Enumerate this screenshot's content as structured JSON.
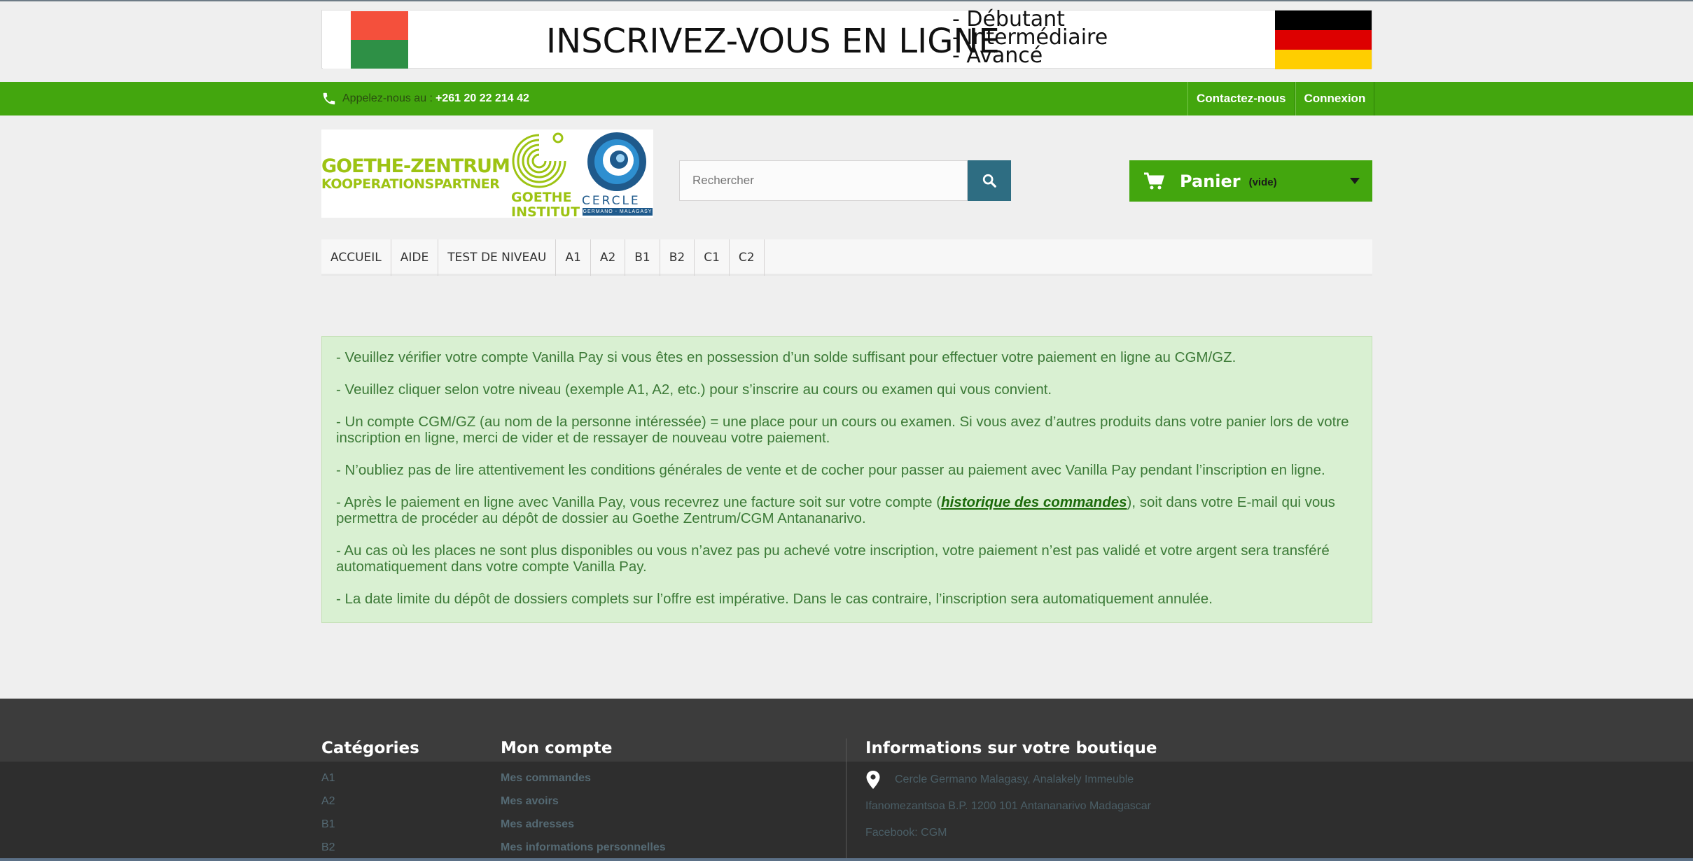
{
  "banner": {
    "title": "INSCRIVEZ-VOUS EN LIGNE",
    "levels": [
      "- Débutant",
      "- Intermédiaire",
      "- Avancé"
    ]
  },
  "topbar": {
    "phone_label": "Appelez-nous au :",
    "phone_number": "+261 20 22 214 42",
    "links": [
      "Contactez-nous",
      "Connexion"
    ]
  },
  "logo": {
    "line1": "GOETHE-ZENTRUM",
    "line2": "KOOPERATIONSPARTNER",
    "goethe": [
      "GOETHE",
      "INSTITUT"
    ],
    "cercle": "CERCLE",
    "cercle_sub": "GERMANO - MALAGASY"
  },
  "search": {
    "placeholder": "Rechercher"
  },
  "cart": {
    "label": "Panier",
    "status": "(vide)"
  },
  "nav": [
    "ACCUEIL",
    "AIDE",
    "TEST DE NIVEAU",
    "A1",
    "A2",
    "B1",
    "B2",
    "C1",
    "C2"
  ],
  "notice": {
    "p1": "- Veuillez vérifier votre compte Vanilla Pay si vous êtes en possession d’un solde suffisant pour effectuer votre paiement en ligne au CGM/GZ.",
    "p2": "- Veuillez cliquer selon votre niveau (exemple A1, A2, etc.) pour s’inscrire au cours ou examen qui vous convient.",
    "p3": "- Un compte CGM/GZ (au nom de la personne intéressée) = une place pour un cours ou examen. Si vous avez d’autres produits dans votre panier lors de votre inscription en ligne, merci de vider et de ressayer de nouveau votre paiement.",
    "p4": "- N’oubliez pas de lire attentivement les conditions générales de vente et de cocher pour passer au paiement avec Vanilla Pay pendant l’inscription en ligne.",
    "p5_before": "- Après le paiement en ligne avec Vanilla Pay, vous recevrez une facture soit sur votre compte (",
    "p5_link": "historique des commandes",
    "p5_after": "), soit dans votre E-mail qui vous permettra de procéder au dépôt de dossier au Goethe Zentrum/CGM Antananarivo.",
    "p6": "- Au cas où les places ne sont plus disponibles ou vous n’avez pas pu achevé votre inscription, votre paiement n’est pas validé et votre argent sera transféré automatiquement dans votre compte Vanilla Pay.",
    "p7": "- La date limite du dépôt de dossiers complets sur l’offre est impérative. Dans le cas contraire, l’inscription sera automatiquement annulée."
  },
  "footer": {
    "categories_title": "Catégories",
    "categories": [
      "A1",
      "A2",
      "B1",
      "B2"
    ],
    "account_title": "Mon compte",
    "account": [
      "Mes commandes",
      "Mes avoirs",
      "Mes adresses",
      "Mes informations personnelles"
    ],
    "info_title": "Informations sur votre boutique",
    "address1": "Cercle Germano Malagasy, Analakely Immeuble",
    "address2": "Ifanomezantsoa B.P. 1200 101 Antananarivo Madagascar",
    "facebook": "Facebook: CGM"
  }
}
